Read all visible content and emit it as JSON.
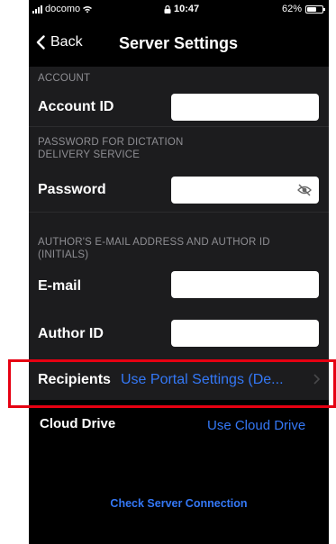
{
  "status_bar": {
    "carrier": "docomo",
    "time": "10:47",
    "battery": "62%",
    "battery_level": 0.62
  },
  "nav": {
    "back_label": "Back",
    "title": "Server Settings"
  },
  "sections": {
    "account_header": "ACCOUNT",
    "account_id_label": "Account ID",
    "account_id_value": "",
    "password_header_line1": "PASSWORD FOR DICTATION",
    "password_header_line2": "DELIVERY SERVICE",
    "password_label": "Password",
    "password_value": "",
    "author_header_line1": "AUTHOR'S E-MAIL ADDRESS AND AUTHOR ID",
    "author_header_line2": "(INITIALS)",
    "email_label": "E-mail",
    "email_value": "",
    "author_id_label": "Author ID",
    "author_id_value": ""
  },
  "recipients": {
    "label": "Recipients",
    "value": "Use Portal Settings (De..."
  },
  "cloud": {
    "label": "Cloud Drive",
    "link": "Use Cloud Drive"
  },
  "check_server": "Check Server Connection",
  "colors": {
    "accent": "#3478f6",
    "highlight": "#e60012",
    "background": "#000000",
    "cell": "#1c1c1e"
  }
}
